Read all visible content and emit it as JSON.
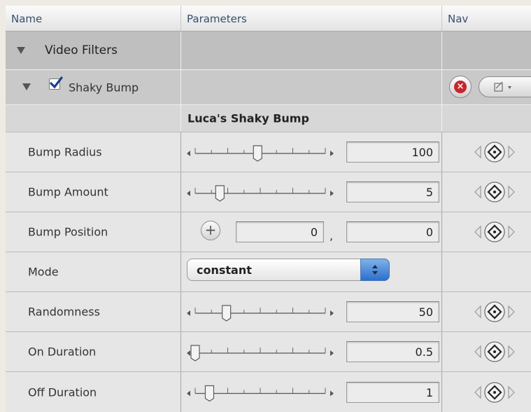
{
  "header": {
    "name": "Name",
    "parameters": "Parameters",
    "nav": "Nav"
  },
  "group": {
    "label": "Video Filters"
  },
  "filter": {
    "label": "Shaky Bump",
    "enabled": true,
    "title": "Luca's Shaky Bump"
  },
  "params": [
    {
      "label": "Bump Radius",
      "value": "100",
      "slider_fraction": 0.48
    },
    {
      "label": "Bump Amount",
      "value": "5",
      "slider_fraction": 0.19
    },
    {
      "label": "Bump Position",
      "x": "0",
      "y": "0",
      "separator": ","
    },
    {
      "label": "Mode",
      "option": "constant"
    },
    {
      "label": "Randomness",
      "value": "50",
      "slider_fraction": 0.24
    },
    {
      "label": "On Duration",
      "value": "0.5",
      "slider_fraction": 0.0
    },
    {
      "label": "Off Duration",
      "value": "1",
      "slider_fraction": 0.11
    }
  ],
  "icons": {
    "disclosure": "disclosure-triangle-icon",
    "reset": "reset-x-icon",
    "keyframe": "keyframe-diamond-icon",
    "add_point": "crosshair-plus-icon"
  },
  "colors": {
    "header_text": "#3a4e6c",
    "reset_red": "#c8242b",
    "popup_blue": "#2c6fcc"
  }
}
